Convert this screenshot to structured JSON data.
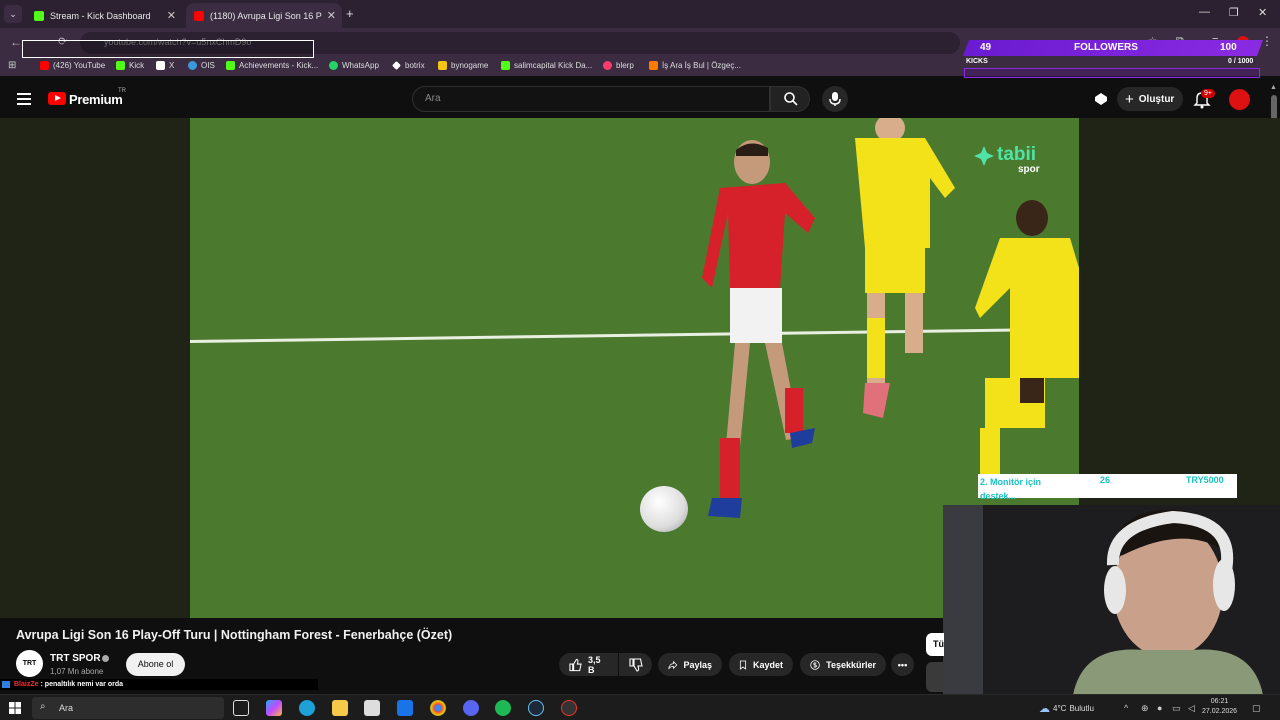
{
  "browser": {
    "tabs": [
      {
        "title": "Stream - Kick Dashboard"
      },
      {
        "title": "(1180) Avrupa Ligi Son 16 P"
      }
    ],
    "new_tab": "+",
    "url": "youtube.com/watch?v=u5nxChmD9o",
    "bookmarks": [
      {
        "label": "(426) YouTube",
        "color": "#ff0000"
      },
      {
        "label": "Kick",
        "color": "#53fc18"
      },
      {
        "label": "X",
        "color": "#ffffff"
      },
      {
        "label": "OIS",
        "color": "#3a9ad9"
      },
      {
        "label": "Achievements - Kick...",
        "color": "#53fc18"
      },
      {
        "label": "WhatsApp",
        "color": "#25d366"
      },
      {
        "label": "botrix",
        "color": "#ffffff"
      },
      {
        "label": "bynogame",
        "color": "#f5c518"
      },
      {
        "label": "salimcapital Kick Da...",
        "color": "#53fc18"
      },
      {
        "label": "blerp",
        "color": "#ff3b6b"
      },
      {
        "label": "İş Ara İş Bul | Özgeç...",
        "color": "#ff7a00"
      }
    ]
  },
  "followers_overlay": {
    "count": "49",
    "label": "FOLLOWERS",
    "goal": "100",
    "kicks_label": "KICKS",
    "kicks_value": "0 / 1000"
  },
  "youtube": {
    "premium_label": "Premium",
    "country_code": "TR",
    "search_placeholder": "Ara",
    "create_label": "Oluştur",
    "notif_badge": "9+"
  },
  "video": {
    "watermark": "tabii",
    "watermark_sub": "spor",
    "title": "Avrupa Ligi Son 16 Play-Off Turu | Nottingham Forest - Fenerbahçe (Özet)"
  },
  "donation": {
    "text": "2. Monitör için destek...",
    "count": "26",
    "goal": "TRY5000"
  },
  "channel": {
    "avatar_text": "TRT",
    "name": "TRT SPOR",
    "subs": "1,07 Mn abone",
    "subscribe_label": "Abone ol"
  },
  "actions": {
    "likes": "3,5 B",
    "share": "Paylaş",
    "save": "Kaydet",
    "thanks": "Teşekkürler",
    "side_chip": "Tü"
  },
  "chat": {
    "user": "BlaizZe",
    "message": ": penaltılık nemi var orda"
  },
  "taskbar": {
    "search": "Ara",
    "weather": "4°C",
    "weather_desc": "Bulutlu",
    "time": "06:21",
    "date": "27.02.2026"
  }
}
